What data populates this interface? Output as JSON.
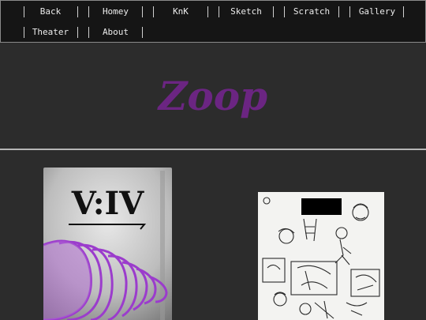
{
  "nav": {
    "links": [
      "Back",
      "Homey",
      "KnK",
      "Sketch",
      "Scratch",
      "Gallery",
      "Theater",
      "About"
    ]
  },
  "header": {
    "title": "Zoop"
  },
  "gallery": {
    "cover_text": "V:IV",
    "colors": {
      "title": "#6b2582",
      "spiral": "#9b3ccc"
    },
    "icons": [
      "purple-spiral-cone",
      "sketch-page"
    ]
  }
}
